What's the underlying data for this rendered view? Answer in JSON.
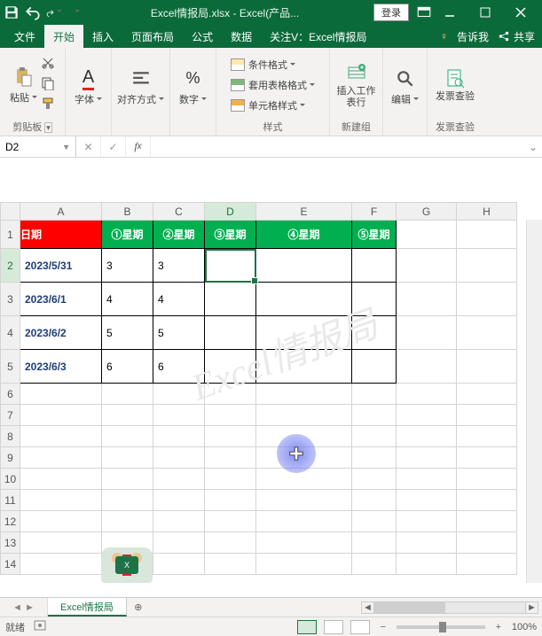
{
  "titlebar": {
    "filename": "Excel情报局.xlsx",
    "app": "Excel(产品...",
    "login": "登录"
  },
  "tabs": {
    "file": "文件",
    "home": "开始",
    "insert": "插入",
    "layout": "页面布局",
    "formulas": "公式",
    "data": "数据",
    "custom": "关注V：Excel情报局",
    "tell_me": "告诉我",
    "share": "共享"
  },
  "ribbon": {
    "paste": "粘贴",
    "clipboard": "剪贴板",
    "font": "字体",
    "alignment": "对齐方式",
    "number": "数字",
    "cond_format": "条件格式",
    "table_format": "套用表格格式",
    "cell_styles": "单元格样式",
    "styles": "样式",
    "insert_ws": "插入工作表行",
    "new_group": "新建组",
    "editing": "编辑",
    "invoice": "发票查验",
    "invoice_group": "发票查验"
  },
  "namebox": {
    "value": "D2"
  },
  "columns": [
    "A",
    "B",
    "C",
    "D",
    "E",
    "F",
    "G",
    "H"
  ],
  "rows": [
    "1",
    "2",
    "3",
    "4",
    "5",
    "6",
    "7",
    "8",
    "9",
    "10",
    "11",
    "12",
    "13",
    "14"
  ],
  "headers": {
    "date": "日期",
    "w1": "①星期",
    "w2": "②星期",
    "w3": "③星期",
    "w4": "④星期",
    "w5": "⑤星期"
  },
  "table": [
    {
      "date": "2023/5/31",
      "v1": "3",
      "v2": "3"
    },
    {
      "date": "2023/6/1",
      "v1": "4",
      "v2": "4"
    },
    {
      "date": "2023/6/2",
      "v1": "5",
      "v2": "5"
    },
    {
      "date": "2023/6/3",
      "v1": "6",
      "v2": "6"
    }
  ],
  "watermark": "Excel情报局",
  "sheet": {
    "name": "Excel情报局"
  },
  "statusbar": {
    "ready": "就绪",
    "zoom": "100%"
  }
}
